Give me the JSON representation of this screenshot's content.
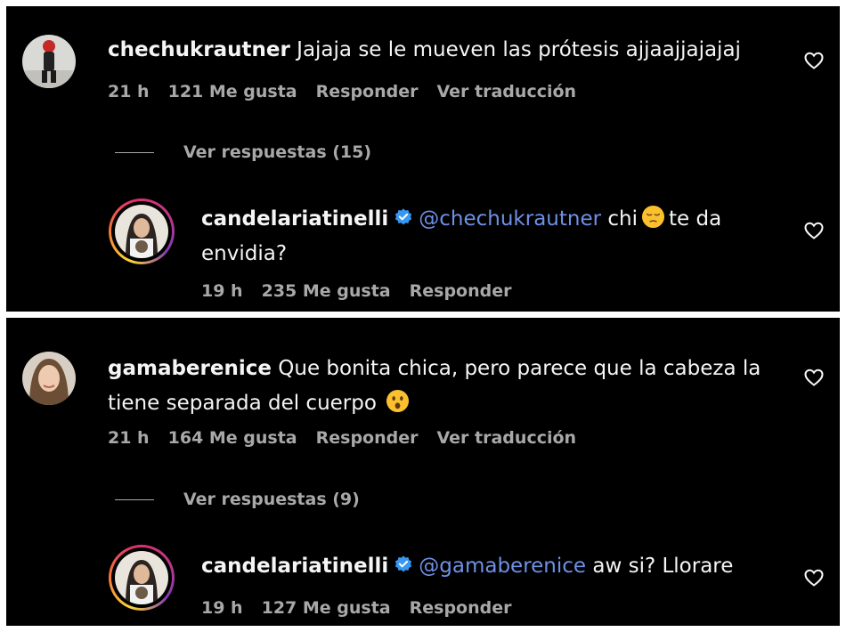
{
  "threads": [
    {
      "comment": {
        "username": "chechukrautner",
        "text": "Jajaja se le mueven las prótesis ajjaajjajajaj",
        "time": "21 h",
        "likes": "121 Me gusta",
        "reply": "Responder",
        "translate": "Ver traducción"
      },
      "view_replies": "Ver respuestas (15)",
      "reply": {
        "username": "candelariatinelli",
        "mention": "@chechukrautner",
        "text_before_emoji": "chi",
        "emoji": "pensive-face-emoji",
        "text_after_emoji": "te da",
        "text_line2": "envidia?",
        "time": "19 h",
        "likes": "235 Me gusta",
        "reply": "Responder"
      }
    },
    {
      "comment": {
        "username": "gamaberenice",
        "text_line1": "Que bonita chica, pero parece que la cabeza la",
        "text_line2": "tiene separada del cuerpo",
        "emoji": "hushed-face-emoji",
        "time": "21 h",
        "likes": "164 Me gusta",
        "reply": "Responder",
        "translate": "Ver traducción"
      },
      "view_replies": "Ver respuestas (9)",
      "reply": {
        "username": "candelariatinelli",
        "mention": "@gamaberenice",
        "text": "aw si? Llorare",
        "time": "19 h",
        "likes": "127 Me gusta",
        "reply": "Responder"
      }
    }
  ],
  "colors": {
    "background": "#000000",
    "text": "#f5f5f5",
    "secondary": "#a8a8a8",
    "mention": "#6f90e6",
    "verified": "#3897f0"
  },
  "icons": {
    "like": "heart-outline-icon",
    "verified": "verified-badge-icon"
  }
}
